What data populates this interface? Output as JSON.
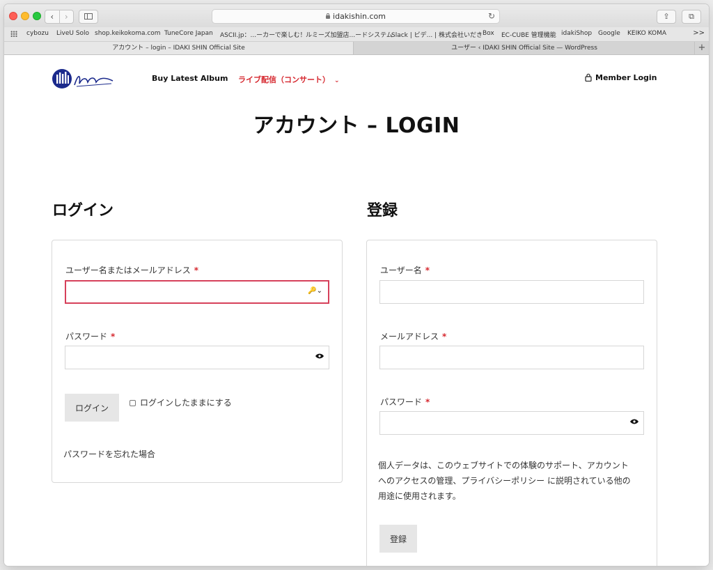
{
  "browser": {
    "nav_back": "‹",
    "nav_forward": "›",
    "url": "idakishin.com",
    "reload": "↻",
    "share": "⇪",
    "tabs_overview": "⧉",
    "bookmarks": [
      "cybozu",
      "LiveU Solo",
      "shop.keikokoma.com",
      "TuneCore Japan",
      "ASCII.jp：...ーカーで楽しむ！",
      "ルミーズ加盟店...ードシステム",
      "Slack | ビデ... | 株式会社いだき",
      "Box",
      "EC-CUBE 管理機能",
      "idakiShop",
      "Google",
      "KEIKO KOMA"
    ],
    "bookmarks_more": ">>",
    "tabs": [
      "アカウント – login – IDAKI SHIN Official Site",
      "ユーザー ‹ IDAKI SHIN Official Site — WordPress"
    ],
    "new_tab": "+"
  },
  "site": {
    "logo_text": "Idaki Shin",
    "nav": {
      "buy_album": "Buy Latest Album",
      "live": "ライブ配信（コンサート）",
      "live_chevron": "⌄",
      "member_login": "Member Login"
    },
    "page_title": "アカウント – LOGIN"
  },
  "login": {
    "heading": "ログイン",
    "username_label": "ユーザー名またはメールアドレス",
    "required": "*",
    "key_icon": "🔑⌄",
    "password_label": "パスワード",
    "submit": "ログイン",
    "remember": "ログインしたままにする",
    "lost_password": "パスワードを忘れた場合"
  },
  "register": {
    "heading": "登録",
    "username_label": "ユーザー名",
    "email_label": "メールアドレス",
    "password_label": "パスワード",
    "required": "*",
    "privacy_text_1": "個人データは、このウェブサイトでの体験のサポート、アカウント",
    "privacy_text_2": "へのアクセスの管理、プライバシーポリシー に説明されている他の",
    "privacy_text_3": "用途に使用されます。",
    "submit": "登録"
  },
  "colors": {
    "accent_red": "#d6282f",
    "focus_border": "#d6405a",
    "logo_blue": "#1b2a8c"
  }
}
